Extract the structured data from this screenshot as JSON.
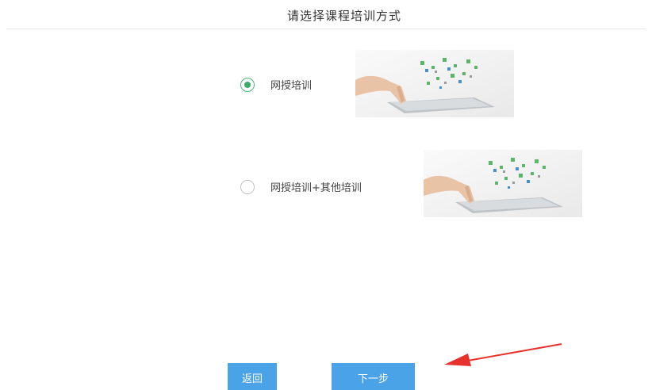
{
  "header": {
    "title": "请选择课程培训方式"
  },
  "options": [
    {
      "label": "网授培训",
      "selected": true,
      "image_icon": "tablet-touch-illustration"
    },
    {
      "label": "网授培训+其他培训",
      "selected": false,
      "image_icon": "tablet-touch-illustration"
    }
  ],
  "buttons": {
    "back_label": "返回",
    "next_label": "下一步"
  },
  "colors": {
    "accent": "#4aa3e6",
    "radio_selected": "#3aab6a",
    "annotation_arrow": "#e8322d"
  }
}
